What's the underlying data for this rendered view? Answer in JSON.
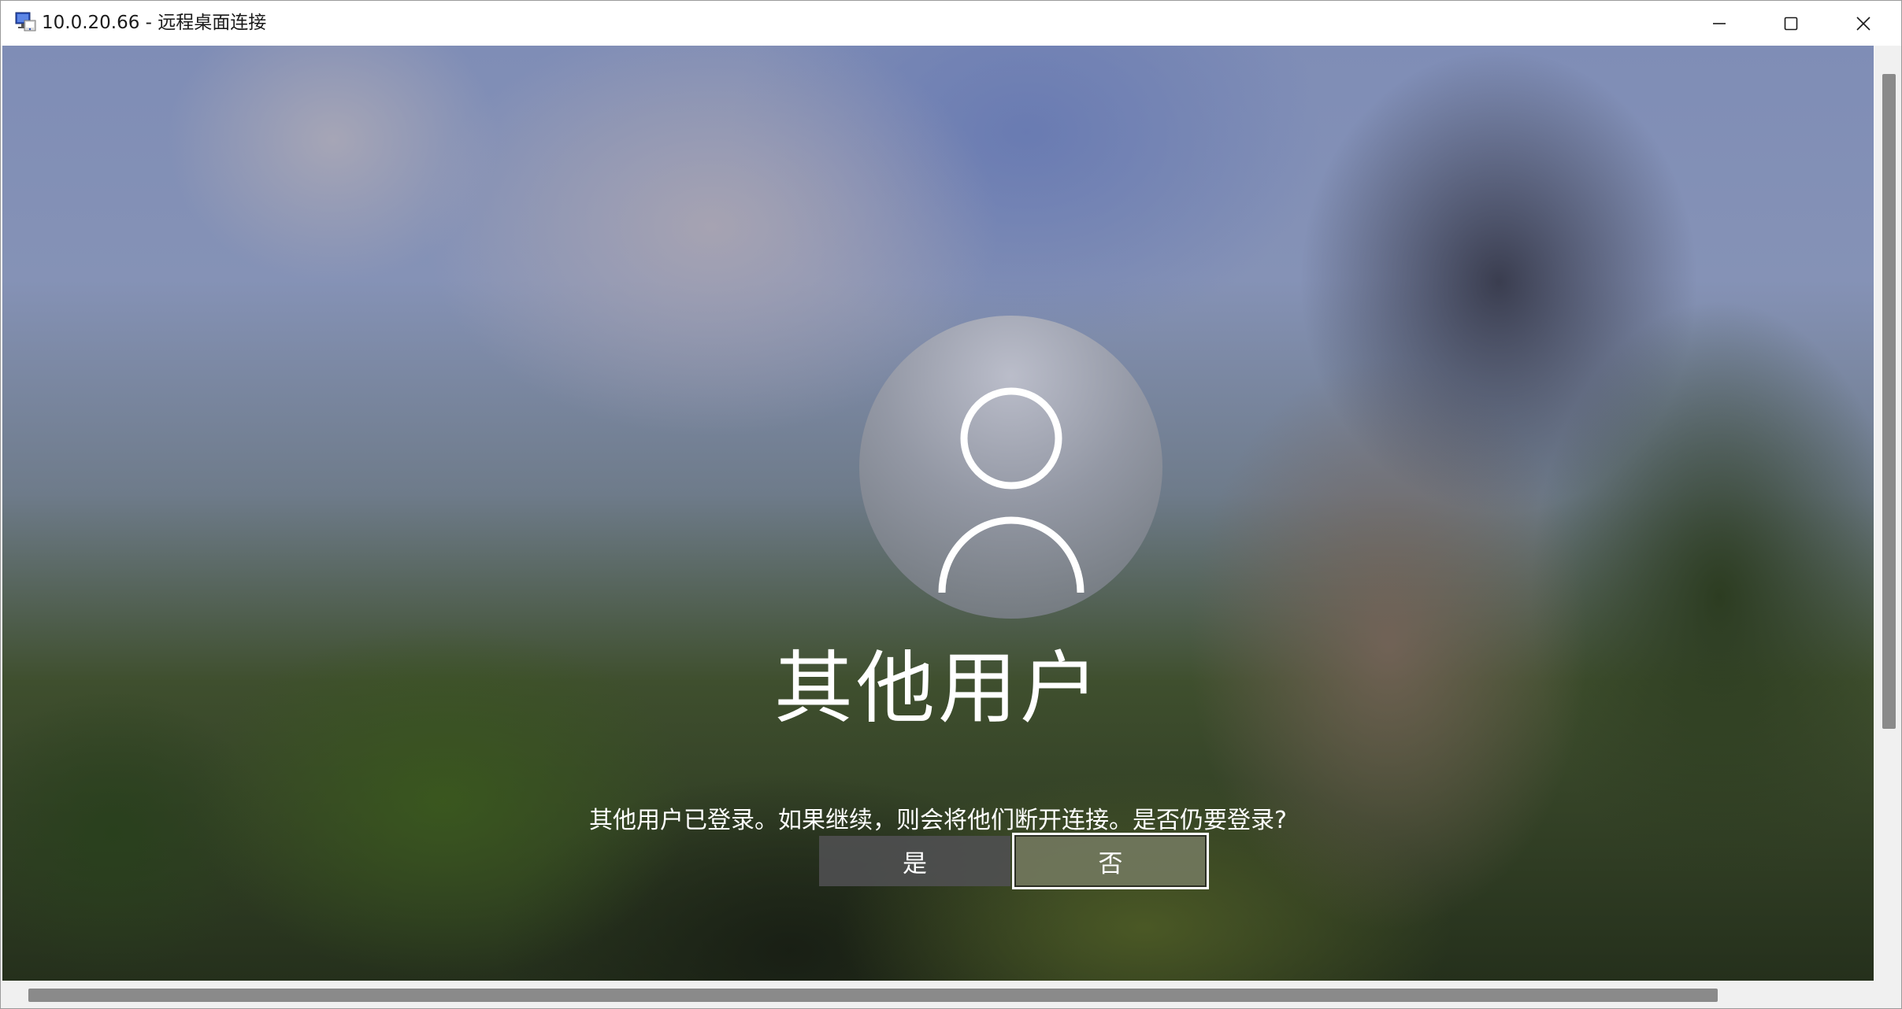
{
  "window": {
    "title": "10.0.20.66 - 远程桌面连接",
    "app_icon": "remote-desktop-icon",
    "controls": [
      "minimize-icon",
      "maximize-icon",
      "close-icon"
    ]
  },
  "login": {
    "avatar_icon": "user-icon",
    "user_name": "其他用户",
    "message": "其他用户已登录。如果继续，则会将他们断开连接。是否仍要登录?",
    "yes_label": "是",
    "no_label": "否"
  },
  "colors": {
    "button_yes_bg": "#505052",
    "button_no_bg": "#70765c",
    "text": "#ffffff",
    "titlebar_bg": "#ffffff"
  }
}
